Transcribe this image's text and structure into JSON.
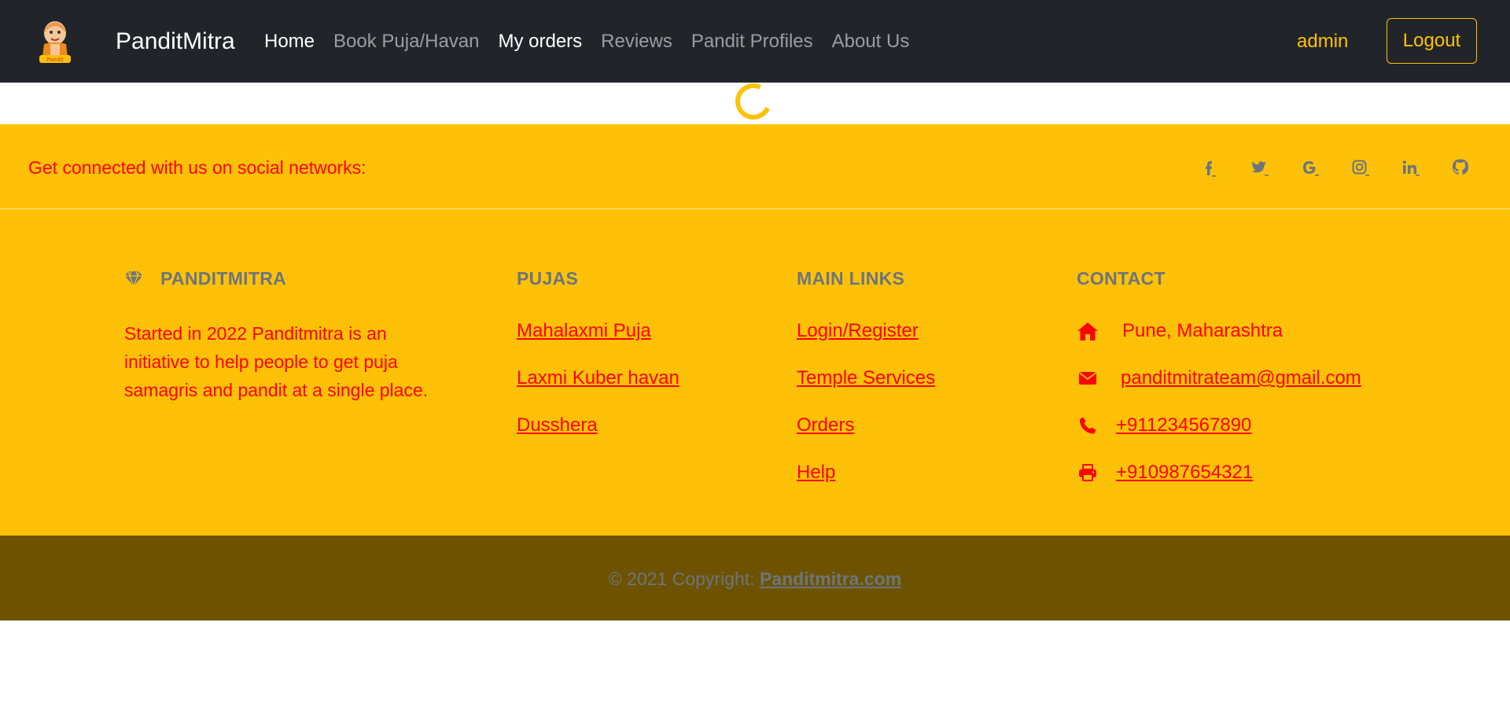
{
  "navbar": {
    "brand": "PanditMitra",
    "links": [
      {
        "label": "Home",
        "active": true
      },
      {
        "label": "Book Puja/Havan",
        "active": false
      },
      {
        "label": "My orders",
        "active": true
      },
      {
        "label": "Reviews",
        "active": false
      },
      {
        "label": "Pandit Profiles",
        "active": false
      },
      {
        "label": "About Us",
        "active": false
      }
    ],
    "user": "admin",
    "logout_label": "Logout"
  },
  "social": {
    "text": "Get connected with us on social networks:",
    "icons": [
      "facebook-icon",
      "twitter-icon",
      "google-icon",
      "instagram-icon",
      "linkedin-icon",
      "github-icon"
    ]
  },
  "footer": {
    "about": {
      "title": "PANDITMITRA",
      "icon": "gem-icon",
      "text": "Started in 2022 Panditmitra is an initiative to help people to get puja samagris and pandit at a single place."
    },
    "pujas": {
      "title": "PUJAS",
      "links": [
        "Mahalaxmi Puja",
        "Laxmi Kuber havan",
        "Dusshera"
      ]
    },
    "main_links": {
      "title": "MAIN LINKS",
      "links": [
        "Login/Register",
        "Temple Services",
        "Orders",
        "Help"
      ]
    },
    "contact": {
      "title": "CONTACT",
      "address": "Pune, Maharashtra",
      "email": "panditmitrateam@gmail.com",
      "phone": "+911234567890",
      "fax": "+910987654321"
    }
  },
  "copyright": {
    "prefix": "© 2021 Copyright: ",
    "site": "Panditmitra.com"
  },
  "colors": {
    "accent": "#ffc107",
    "nav_bg": "#212529",
    "link_red": "#ff0000",
    "muted": "#6c757d",
    "copyright_bg": "#6d5300"
  }
}
